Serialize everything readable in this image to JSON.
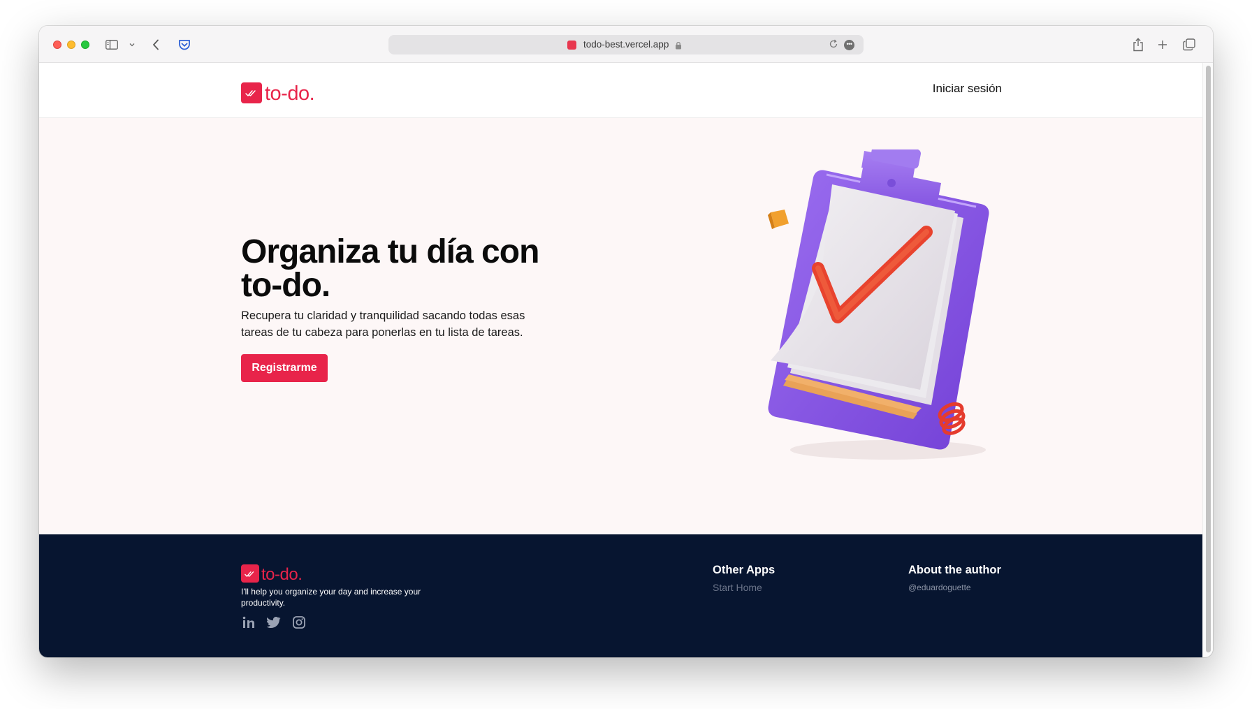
{
  "browser": {
    "url": "todo-best.vercel.app",
    "more_label": "•••"
  },
  "nav": {
    "logo_text": "to-do.",
    "login_label": "Iniciar sesión"
  },
  "hero": {
    "title": "Organiza tu día con to-do.",
    "description": "Recupera tu claridad y tranquilidad sacando todas esas tareas de tu cabeza para ponerlas en tu lista de tareas.",
    "cta_label": "Registrarme"
  },
  "footer": {
    "logo_text": "to-do.",
    "tagline": "I'll help you organize your day and increase your productivity.",
    "socials": [
      "linkedin-icon",
      "twitter-icon",
      "instagram-icon"
    ],
    "other_apps": {
      "title": "Other Apps",
      "links": [
        "Start Home"
      ]
    },
    "about": {
      "title": "About the author",
      "handle": "@eduardoguette"
    }
  },
  "colors": {
    "brand": "#e8244a",
    "footer_bg": "#071530",
    "hero_bg": "#fdf7f7"
  }
}
